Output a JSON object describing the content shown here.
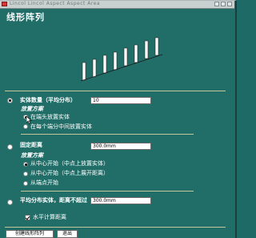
{
  "window": {
    "caption": "Lincol Lincol Aspect Aspect Area"
  },
  "header": {
    "title": "线形阵列"
  },
  "section_count": {
    "label": "实体数量（平均分布）",
    "value": "10",
    "sub_heading": "放置方案",
    "options": [
      "在端头放置实体",
      "在每个端分中间放置实体"
    ]
  },
  "section_fixed": {
    "label": "固定距离",
    "value": "300.0mm",
    "sub_heading": "放置方案",
    "options": [
      "从中心开始（中点上放置实体）",
      "从中心开始（中点上展开距离）",
      "从端点开始"
    ]
  },
  "section_avg": {
    "label": "平均分布实体，距离不超过",
    "value": "300.0mm",
    "checkbox_label": "水平计算距离"
  },
  "buttons": {
    "create": "创建线形阵列",
    "exit": "退出"
  },
  "colors": {
    "background": "#216d68",
    "separator": "#c4c69a"
  }
}
